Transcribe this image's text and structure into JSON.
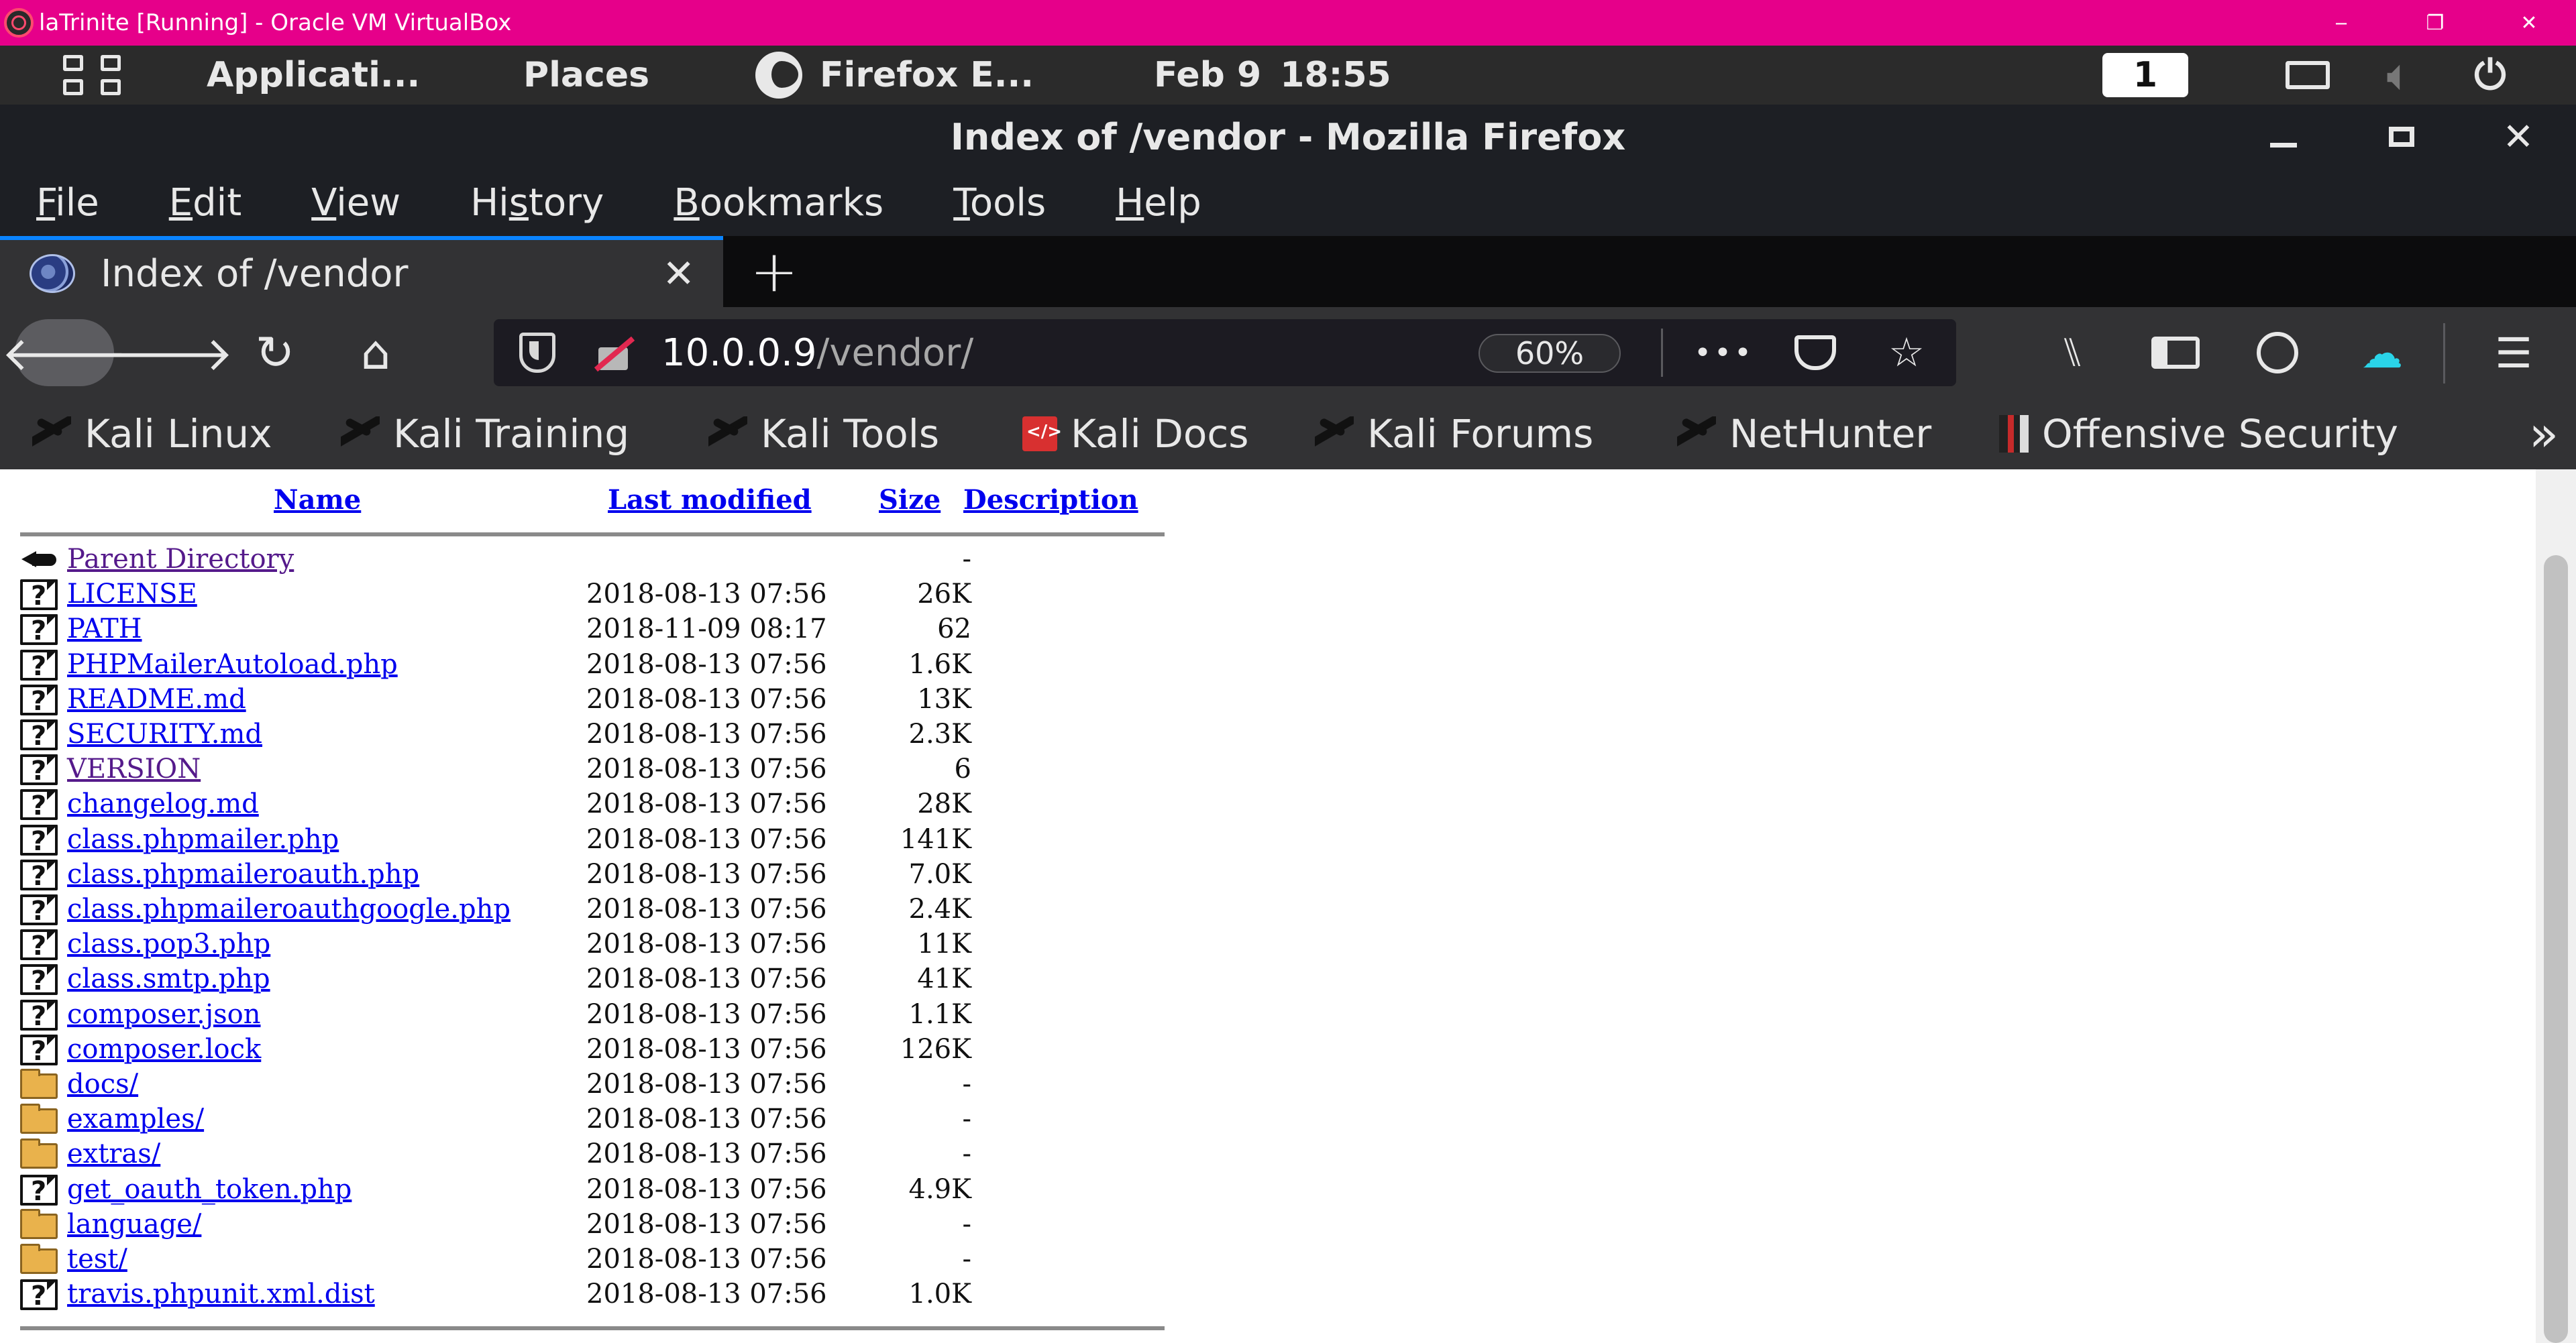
{
  "vbox": {
    "title": "laTrinite [Running] - Oracle VM VirtualBox",
    "minimize": "‒",
    "restore": "❐",
    "close": "✕"
  },
  "panel": {
    "applications": "Applicati...",
    "places": "Places",
    "active_app": "Firefox E...",
    "date": "Feb 9",
    "time": "18:55",
    "workspace": "1"
  },
  "firefox": {
    "window_title": "Index of /vendor - Mozilla Firefox",
    "menus": [
      {
        "pre": "",
        "u": "F",
        "post": "ile"
      },
      {
        "pre": "",
        "u": "E",
        "post": "dit"
      },
      {
        "pre": "",
        "u": "V",
        "post": "iew"
      },
      {
        "pre": "Hi",
        "u": "s",
        "post": "tory"
      },
      {
        "pre": "",
        "u": "B",
        "post": "ookmarks"
      },
      {
        "pre": "",
        "u": "T",
        "post": "ools"
      },
      {
        "pre": "",
        "u": "H",
        "post": "elp"
      }
    ],
    "tab_title": "Index of /vendor",
    "url_host": "10.0.0.9",
    "url_path": "/vendor/",
    "zoom": "60%",
    "bookmarks": [
      {
        "label": "Kali Linux",
        "icon": "kali-dragon-icon"
      },
      {
        "label": "Kali Training",
        "icon": "kali-dragon-icon"
      },
      {
        "label": "Kali Tools",
        "icon": "kali-dragon-icon"
      },
      {
        "label": "Kali Docs",
        "icon": "kali-docs-icon"
      },
      {
        "label": "Kali Forums",
        "icon": "kali-dragon-icon"
      },
      {
        "label": "NetHunter",
        "icon": "nethunter-icon"
      },
      {
        "label": "Offensive Security",
        "icon": "offsec-icon"
      }
    ]
  },
  "listing": {
    "headers": {
      "name": "Name",
      "modified": "Last modified",
      "size": "Size",
      "description": "Description"
    },
    "rows": [
      {
        "icon": "back",
        "name": "Parent Directory",
        "modified": "",
        "size": "-",
        "visited": true
      },
      {
        "icon": "file",
        "name": "LICENSE",
        "modified": "2018-08-13 07:56",
        "size": "26K",
        "visited": false
      },
      {
        "icon": "file",
        "name": "PATH",
        "modified": "2018-11-09 08:17",
        "size": "62",
        "visited": false
      },
      {
        "icon": "file",
        "name": "PHPMailerAutoload.php",
        "modified": "2018-08-13 07:56",
        "size": "1.6K",
        "visited": false
      },
      {
        "icon": "file",
        "name": "README.md",
        "modified": "2018-08-13 07:56",
        "size": "13K",
        "visited": false
      },
      {
        "icon": "file",
        "name": "SECURITY.md",
        "modified": "2018-08-13 07:56",
        "size": "2.3K",
        "visited": false
      },
      {
        "icon": "file",
        "name": "VERSION",
        "modified": "2018-08-13 07:56",
        "size": "6",
        "visited": true
      },
      {
        "icon": "file",
        "name": "changelog.md",
        "modified": "2018-08-13 07:56",
        "size": "28K",
        "visited": false
      },
      {
        "icon": "file",
        "name": "class.phpmailer.php",
        "modified": "2018-08-13 07:56",
        "size": "141K",
        "visited": false
      },
      {
        "icon": "file",
        "name": "class.phpmaileroauth.php",
        "modified": "2018-08-13 07:56",
        "size": "7.0K",
        "visited": false
      },
      {
        "icon": "file",
        "name": "class.phpmaileroauthgoogle.php",
        "modified": "2018-08-13 07:56",
        "size": "2.4K",
        "visited": false
      },
      {
        "icon": "file",
        "name": "class.pop3.php",
        "modified": "2018-08-13 07:56",
        "size": "11K",
        "visited": false
      },
      {
        "icon": "file",
        "name": "class.smtp.php",
        "modified": "2018-08-13 07:56",
        "size": "41K",
        "visited": false
      },
      {
        "icon": "file",
        "name": "composer.json",
        "modified": "2018-08-13 07:56",
        "size": "1.1K",
        "visited": false
      },
      {
        "icon": "file",
        "name": "composer.lock",
        "modified": "2018-08-13 07:56",
        "size": "126K",
        "visited": false
      },
      {
        "icon": "folder",
        "name": "docs/",
        "modified": "2018-08-13 07:56",
        "size": "-",
        "visited": false
      },
      {
        "icon": "folder",
        "name": "examples/",
        "modified": "2018-08-13 07:56",
        "size": "-",
        "visited": false
      },
      {
        "icon": "folder",
        "name": "extras/",
        "modified": "2018-08-13 07:56",
        "size": "-",
        "visited": false
      },
      {
        "icon": "file",
        "name": "get_oauth_token.php",
        "modified": "2018-08-13 07:56",
        "size": "4.9K",
        "visited": false
      },
      {
        "icon": "folder",
        "name": "language/",
        "modified": "2018-08-13 07:56",
        "size": "-",
        "visited": false
      },
      {
        "icon": "folder",
        "name": "test/",
        "modified": "2018-08-13 07:56",
        "size": "-",
        "visited": false
      },
      {
        "icon": "file",
        "name": "travis.phpunit.xml.dist",
        "modified": "2018-08-13 07:56",
        "size": "1.0K",
        "visited": false
      }
    ]
  },
  "colors": {
    "vbox_bar": "#e6008a",
    "link": "#0000ee",
    "visited_link": "#551a8b",
    "accent": "#0a84ff",
    "sync": "#2ad4e8"
  }
}
